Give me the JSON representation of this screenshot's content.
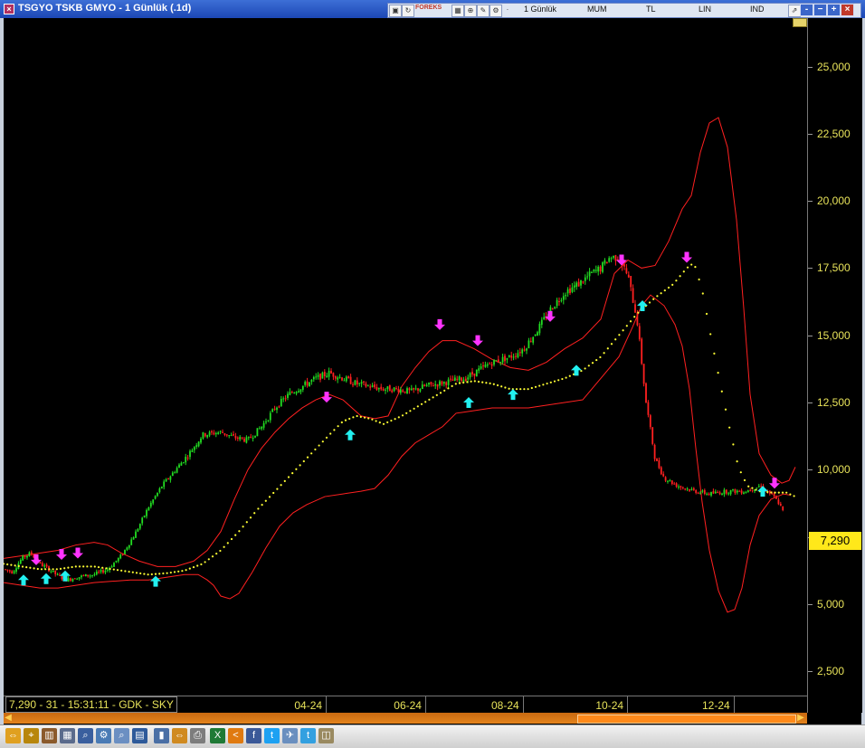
{
  "window": {
    "title": "TSGYO TSKB GMYO - 1 Günlük (.1d)",
    "toolbar": {
      "forex_label": "FOREKS",
      "period_label": "1 Günlük",
      "chart_type_label": "MUM",
      "currency_label": "TL",
      "scale_label": "LIN",
      "indicator_label": "IND"
    },
    "controls": {
      "minus": "-",
      "minimize": "−",
      "add": "+",
      "close": "×"
    }
  },
  "status": {
    "text": "7,290 - 31 - 15:31:11 - GDK - SKY"
  },
  "last_price": {
    "label": "7,290",
    "value": 7290
  },
  "chart_data": {
    "type": "line",
    "y_axis": {
      "ticks": [
        "25,000",
        "22,500",
        "20,000",
        "17,500",
        "15,000",
        "12,500",
        "10,000",
        "7,500",
        "5,000",
        "2,500"
      ],
      "tick_values": [
        25000,
        22500,
        20000,
        17500,
        15000,
        12500,
        10000,
        7500,
        5000,
        2500
      ],
      "ylim": [
        1600,
        26800
      ]
    },
    "x_axis": {
      "labels": [
        "04-24",
        "06-24",
        "08-24",
        "10-24",
        "12-24"
      ],
      "label_positions_days": [
        80,
        180,
        278,
        383,
        490
      ],
      "xlim": [
        -244,
        564
      ]
    },
    "colors": {
      "background": "#000000",
      "up_candle": "#22dd22",
      "down_candle": "#ff2020",
      "bands": "#ff2020",
      "average": "#ffff33",
      "buy_arrow": "#22f0f0",
      "sell_arrow": "#ff33ff"
    },
    "series": [
      {
        "points": [
          [
            0,
            6300
          ],
          [
            10,
            6200
          ],
          [
            20,
            6700
          ],
          [
            30,
            6900
          ],
          [
            40,
            6500
          ],
          [
            50,
            6300
          ],
          [
            60,
            6050
          ],
          [
            70,
            5900
          ],
          [
            80,
            6000
          ],
          [
            100,
            6100
          ],
          [
            115,
            6300
          ],
          [
            130,
            6800
          ],
          [
            145,
            7600
          ],
          [
            160,
            8600
          ],
          [
            175,
            9400
          ],
          [
            190,
            10000
          ],
          [
            205,
            10600
          ],
          [
            220,
            11300
          ],
          [
            240,
            11400
          ],
          [
            255,
            11200
          ],
          [
            270,
            11100
          ],
          [
            285,
            11600
          ],
          [
            300,
            12300
          ],
          [
            315,
            12800
          ],
          [
            330,
            13100
          ],
          [
            345,
            13400
          ],
          [
            360,
            13600
          ],
          [
            375,
            13400
          ],
          [
            390,
            13200
          ],
          [
            405,
            13100
          ],
          [
            420,
            13000
          ],
          [
            435,
            13000
          ],
          [
            450,
            12900
          ],
          [
            465,
            13100
          ],
          [
            480,
            13200
          ],
          [
            495,
            13300
          ],
          [
            510,
            13400
          ],
          [
            520,
            13600
          ],
          [
            540,
            14000
          ],
          [
            560,
            14200
          ],
          [
            575,
            14500
          ],
          [
            590,
            15200
          ],
          [
            605,
            16000
          ],
          [
            620,
            16600
          ],
          [
            635,
            16900
          ],
          [
            650,
            17300
          ],
          [
            660,
            17500
          ],
          [
            670,
            17900
          ],
          [
            680,
            17900
          ],
          [
            690,
            17200
          ],
          [
            700,
            15600
          ],
          [
            710,
            12500
          ],
          [
            720,
            10400
          ],
          [
            730,
            9700
          ],
          [
            745,
            9400
          ],
          [
            765,
            9200
          ],
          [
            780,
            9100
          ],
          [
            800,
            9200
          ],
          [
            820,
            9200
          ],
          [
            835,
            9400
          ],
          [
            848,
            9100
          ],
          [
            856,
            8800
          ],
          [
            862,
            8400
          ]
        ]
      },
      {
        "points": [
          [
            0,
            5800
          ],
          [
            20,
            5700
          ],
          [
            40,
            5600
          ],
          [
            60,
            5600
          ],
          [
            80,
            5700
          ],
          [
            100,
            5800
          ],
          [
            120,
            5850
          ],
          [
            140,
            5900
          ],
          [
            160,
            5900
          ],
          [
            180,
            6000
          ],
          [
            200,
            6100
          ],
          [
            215,
            6100
          ],
          [
            225,
            5900
          ],
          [
            232,
            5700
          ],
          [
            240,
            5300
          ],
          [
            250,
            5200
          ],
          [
            260,
            5400
          ],
          [
            275,
            6200
          ],
          [
            290,
            7100
          ],
          [
            305,
            7900
          ],
          [
            320,
            8400
          ],
          [
            335,
            8700
          ],
          [
            355,
            9000
          ],
          [
            375,
            9100
          ],
          [
            395,
            9200
          ],
          [
            410,
            9300
          ],
          [
            425,
            9800
          ],
          [
            440,
            10500
          ],
          [
            455,
            11000
          ],
          [
            470,
            11300
          ],
          [
            485,
            11600
          ],
          [
            500,
            12100
          ],
          [
            520,
            12200
          ],
          [
            540,
            12300
          ],
          [
            560,
            12300
          ],
          [
            580,
            12300
          ],
          [
            600,
            12400
          ],
          [
            620,
            12500
          ],
          [
            640,
            12600
          ],
          [
            660,
            13400
          ],
          [
            680,
            14200
          ],
          [
            695,
            15300
          ],
          [
            705,
            16100
          ],
          [
            715,
            16500
          ],
          [
            730,
            16100
          ],
          [
            742,
            15400
          ],
          [
            750,
            14600
          ],
          [
            758,
            13000
          ],
          [
            765,
            10800
          ],
          [
            772,
            8800
          ],
          [
            780,
            7000
          ],
          [
            790,
            5500
          ],
          [
            800,
            4700
          ],
          [
            808,
            4800
          ],
          [
            816,
            5600
          ],
          [
            825,
            7200
          ],
          [
            835,
            8300
          ],
          [
            848,
            8900
          ],
          [
            862,
            9100
          ],
          [
            870,
            9050
          ]
        ]
      },
      {
        "points": [
          [
            0,
            6700
          ],
          [
            20,
            6800
          ],
          [
            40,
            6900
          ],
          [
            60,
            7000
          ],
          [
            80,
            7200
          ],
          [
            100,
            7300
          ],
          [
            115,
            7200
          ],
          [
            130,
            6900
          ],
          [
            150,
            6600
          ],
          [
            170,
            6400
          ],
          [
            190,
            6400
          ],
          [
            210,
            6600
          ],
          [
            225,
            7000
          ],
          [
            240,
            7700
          ],
          [
            255,
            8900
          ],
          [
            270,
            10000
          ],
          [
            285,
            10800
          ],
          [
            300,
            11400
          ],
          [
            315,
            11900
          ],
          [
            330,
            12300
          ],
          [
            345,
            12600
          ],
          [
            360,
            12800
          ],
          [
            375,
            12600
          ],
          [
            395,
            12000
          ],
          [
            410,
            11900
          ],
          [
            425,
            12000
          ],
          [
            440,
            13100
          ],
          [
            455,
            13800
          ],
          [
            470,
            14400
          ],
          [
            485,
            14800
          ],
          [
            500,
            14800
          ],
          [
            520,
            14500
          ],
          [
            540,
            14100
          ],
          [
            560,
            13800
          ],
          [
            580,
            13700
          ],
          [
            600,
            14000
          ],
          [
            620,
            14500
          ],
          [
            640,
            14900
          ],
          [
            660,
            15600
          ],
          [
            675,
            17300
          ],
          [
            690,
            17800
          ],
          [
            705,
            17500
          ],
          [
            720,
            17600
          ],
          [
            735,
            18500
          ],
          [
            750,
            19700
          ],
          [
            760,
            20200
          ],
          [
            770,
            21800
          ],
          [
            780,
            22900
          ],
          [
            790,
            23100
          ],
          [
            800,
            22000
          ],
          [
            810,
            19300
          ],
          [
            818,
            16000
          ],
          [
            825,
            12800
          ],
          [
            835,
            10600
          ],
          [
            848,
            9800
          ],
          [
            860,
            9500
          ],
          [
            868,
            9600
          ],
          [
            875,
            10100
          ]
        ]
      },
      {
        "points": [
          [
            0,
            6500
          ],
          [
            20,
            6400
          ],
          [
            40,
            6300
          ],
          [
            60,
            6300
          ],
          [
            80,
            6400
          ],
          [
            100,
            6400
          ],
          [
            120,
            6300
          ],
          [
            140,
            6200
          ],
          [
            160,
            6100
          ],
          [
            180,
            6150
          ],
          [
            200,
            6250
          ],
          [
            220,
            6500
          ],
          [
            240,
            7000
          ],
          [
            260,
            7700
          ],
          [
            280,
            8500
          ],
          [
            300,
            9200
          ],
          [
            320,
            9900
          ],
          [
            340,
            10600
          ],
          [
            360,
            11300
          ],
          [
            375,
            11800
          ],
          [
            390,
            12000
          ],
          [
            405,
            11900
          ],
          [
            420,
            11700
          ],
          [
            440,
            12000
          ],
          [
            460,
            12400
          ],
          [
            480,
            12800
          ],
          [
            500,
            13200
          ],
          [
            520,
            13300
          ],
          [
            540,
            13200
          ],
          [
            560,
            13000
          ],
          [
            580,
            13000
          ],
          [
            600,
            13200
          ],
          [
            620,
            13400
          ],
          [
            640,
            13700
          ],
          [
            660,
            14200
          ],
          [
            680,
            15000
          ],
          [
            700,
            15800
          ],
          [
            720,
            16400
          ],
          [
            740,
            16900
          ],
          [
            755,
            17500
          ],
          [
            763,
            17700
          ],
          [
            772,
            16700
          ],
          [
            782,
            14900
          ],
          [
            792,
            13200
          ],
          [
            802,
            11600
          ],
          [
            812,
            10100
          ],
          [
            822,
            9400
          ],
          [
            835,
            9200
          ],
          [
            850,
            9150
          ],
          [
            865,
            9150
          ],
          [
            875,
            9000
          ]
        ]
      }
    ],
    "markers": {
      "buy": [
        [
          22,
          5900
        ],
        [
          47,
          5950
        ],
        [
          68,
          6050
        ],
        [
          168,
          5850
        ],
        [
          383,
          11300
        ],
        [
          514,
          12500
        ],
        [
          563,
          12800
        ],
        [
          633,
          13700
        ],
        [
          706,
          16100
        ],
        [
          839,
          9200
        ]
      ],
      "sell": [
        [
          36,
          6650
        ],
        [
          64,
          6850
        ],
        [
          82,
          6900
        ],
        [
          357,
          12700
        ],
        [
          482,
          15400
        ],
        [
          524,
          14800
        ],
        [
          604,
          15700
        ],
        [
          683,
          17800
        ],
        [
          755,
          17900
        ],
        [
          852,
          9500
        ]
      ]
    }
  }
}
